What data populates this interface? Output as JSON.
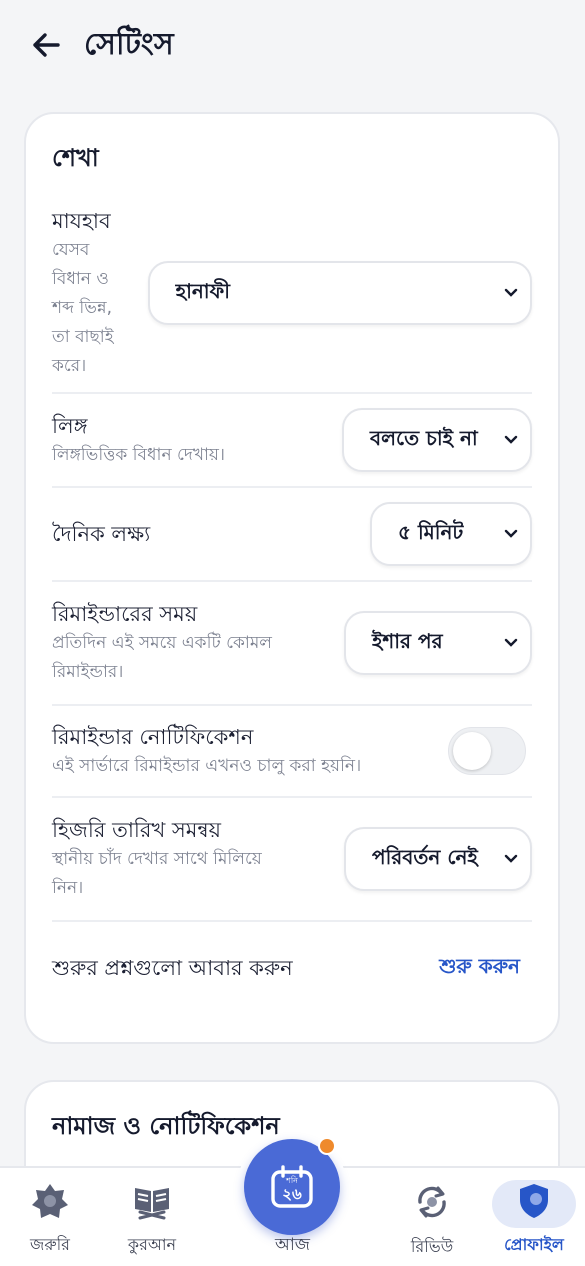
{
  "header": {
    "title": "সেটিংস",
    "back_icon": "arrow-left-icon"
  },
  "learning": {
    "title": "শেখা",
    "madhab": {
      "label": "মাযহাব",
      "desc": "যেসব\nবিধান ও\nশব্দ ভিন্ন,\nতা বাছাই\nকরে।",
      "value": "হানাফী"
    },
    "gender": {
      "label": "লিঙ্গ",
      "desc": "লিঙ্গভিত্তিক বিধান দেখায়।",
      "value": "বলতে চাই না"
    },
    "daily_goal": {
      "label": "দৈনিক লক্ষ্য",
      "value": "৫ মিনিট"
    },
    "reminder_time": {
      "label": "রিমাইন্ডারের সময়",
      "desc": "প্রতিদিন এই সময়ে একটি কোমল\nরিমাইন্ডার।",
      "value": "ইশার পর"
    },
    "reminder_notification": {
      "label": "রিমাইন্ডার নোটিফিকেশন",
      "desc": "এই সার্ভারে রিমাইন্ডার এখনও চালু করা হয়নি।",
      "enabled": false
    },
    "hijri_adjust": {
      "label": "হিজরি তারিখ সমন্বয়",
      "desc": "স্থানীয় চাঁদ দেখার সাথে মিলিয়ে\nনিন।",
      "value": "পরিবর্তন নেই"
    },
    "restart_questions": {
      "label": "শুরুর প্রশ্নগুলো আবার করুন",
      "action": "শুরু করুন"
    }
  },
  "prayer": {
    "title": "নামাজ ও নোটিফিকেশন"
  },
  "nav": {
    "essentials": {
      "label": "জরুরি",
      "icon": "star-badge-icon"
    },
    "quran": {
      "label": "কুরআন",
      "icon": "quran-book-icon"
    },
    "today": {
      "label": "আজ",
      "weekday": "শনি",
      "date": "২৬",
      "icon": "calendar-icon"
    },
    "review": {
      "label": "রিভিউ",
      "icon": "review-cycle-icon"
    },
    "profile": {
      "label": "প্রোফাইল",
      "icon": "shield-profile-icon"
    }
  },
  "colors": {
    "accent": "#2756c8",
    "today_button": "#4a6ad6",
    "badge": "#ef8a2c",
    "background": "#f4f5f7"
  }
}
